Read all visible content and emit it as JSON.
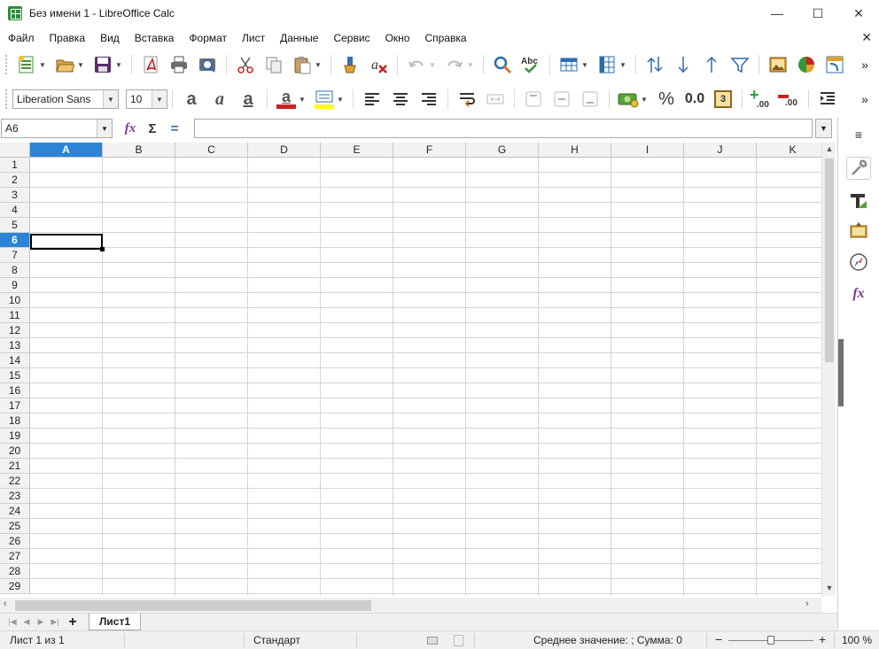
{
  "window": {
    "title": "Без имени 1 - LibreOffice Calc",
    "app_icon": "calc-spreadsheet-icon",
    "minimize_glyph": "—",
    "maximize_glyph": "☐",
    "close_glyph": "✕"
  },
  "menubar": {
    "items": [
      "Файл",
      "Правка",
      "Вид",
      "Вставка",
      "Формат",
      "Лист",
      "Данные",
      "Сервис",
      "Окно",
      "Справка"
    ],
    "close_doc_glyph": "✕"
  },
  "toolbar_standard": {
    "icons": [
      "new-document-icon",
      "open-folder-icon",
      "save-icon",
      "export-pdf-icon",
      "print-icon",
      "print-preview-icon",
      "cut-icon",
      "copy-icon",
      "paste-icon",
      "clone-formatting-icon",
      "clear-formatting-icon",
      "undo-icon",
      "redo-icon",
      "find-replace-icon",
      "spelling-icon",
      "row-icon",
      "column-icon",
      "sort-icon",
      "sort-ascending-icon",
      "sort-descending-icon",
      "autofilter-icon",
      "insert-image-icon",
      "insert-chart-icon",
      "pivot-table-icon"
    ],
    "overflow_glyph": "»"
  },
  "toolbar_formatting": {
    "font_name": "Liberation Sans",
    "font_size": "10",
    "bold_glyph": "a",
    "italic_glyph": "a",
    "underline_glyph": "a",
    "font_color_glyph": "a",
    "percent_glyph": "%",
    "number_glyph": "0.0",
    "date_glyph": "3",
    "add_decimal_glyph": ".00",
    "delete_decimal_glyph": ".00",
    "overflow_glyph": "»",
    "colors": {
      "font_color": "#c9211e",
      "highlight": "#ffff00"
    }
  },
  "formula_bar": {
    "name_box_value": "A6",
    "function_wizard_glyph": "fx",
    "sum_glyph": "Σ",
    "equals_glyph": "=",
    "formula_value": ""
  },
  "sheet": {
    "columns": [
      "A",
      "B",
      "C",
      "D",
      "E",
      "F",
      "G",
      "H",
      "I",
      "J",
      "K"
    ],
    "rows": [
      "1",
      "2",
      "3",
      "4",
      "5",
      "6",
      "7",
      "8",
      "9",
      "10",
      "11",
      "12",
      "13",
      "14",
      "15",
      "16",
      "17",
      "18",
      "19",
      "20",
      "21",
      "22",
      "23",
      "24",
      "25",
      "26",
      "27",
      "28",
      "29"
    ],
    "active_column": "A",
    "active_row": "6",
    "selection_color": "#2b84d6"
  },
  "sidebar": {
    "menu_glyph": "≡",
    "icons": [
      "properties-wrench-icon",
      "styles-icon",
      "gallery-icon",
      "navigator-compass-icon",
      "functions-fx-icon"
    ]
  },
  "sheet_tabs": {
    "add_glyph": "+",
    "tabs": [
      "Лист1"
    ]
  },
  "statusbar": {
    "sheet_info": "Лист 1 из 1",
    "page_style": "Стандарт",
    "summary": "Среднее значение: ; Сумма: 0",
    "zoom_minus": "−",
    "zoom_plus": "+",
    "zoom": "100 %",
    "zoom_level_percent": 100
  }
}
